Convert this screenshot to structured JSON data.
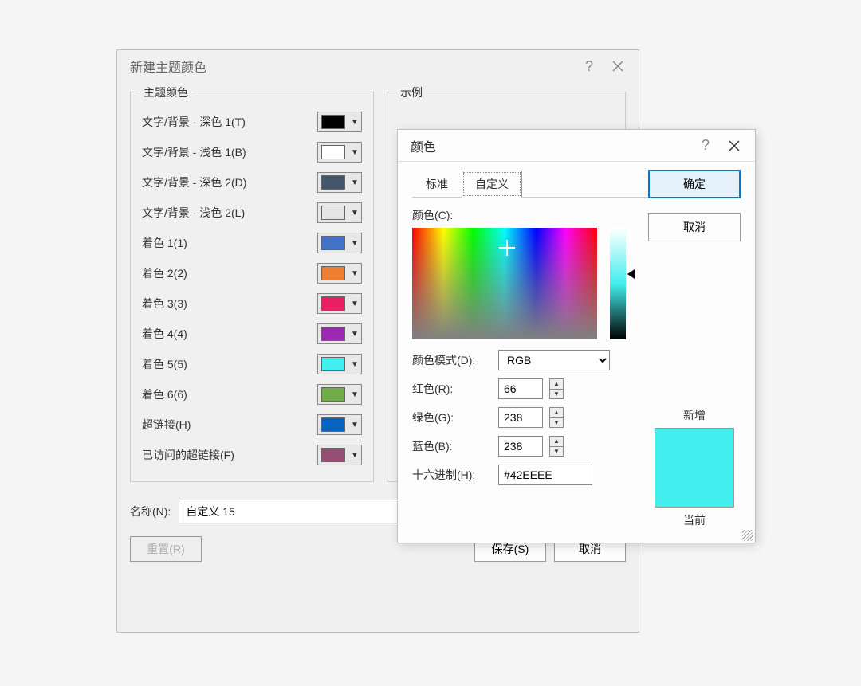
{
  "themeDialog": {
    "title": "新建主题颜色",
    "groupThemeColors": "主题颜色",
    "groupSample": "示例",
    "rows": [
      {
        "label": "文字/背景 - 深色 1(T)",
        "color": "#000000"
      },
      {
        "label": "文字/背景 - 浅色 1(B)",
        "color": "#ffffff"
      },
      {
        "label": "文字/背景 - 深色 2(D)",
        "color": "#44546a"
      },
      {
        "label": "文字/背景 - 浅色 2(L)",
        "color": "#e7e6e6"
      },
      {
        "label": "着色 1(1)",
        "color": "#4472c4"
      },
      {
        "label": "着色 2(2)",
        "color": "#ed7d31"
      },
      {
        "label": "着色 3(3)",
        "color": "#e91e63"
      },
      {
        "label": "着色 4(4)",
        "color": "#9c27b0"
      },
      {
        "label": "着色 5(5)",
        "color": "#42eeee"
      },
      {
        "label": "着色 6(6)",
        "color": "#70ad47"
      },
      {
        "label": "超链接(H)",
        "color": "#0563c1"
      },
      {
        "label": "已访问的超链接(F)",
        "color": "#954f72"
      }
    ],
    "nameLabel": "名称(N):",
    "nameValue": "自定义 15",
    "reset": "重置(R)",
    "save": "保存(S)",
    "cancel": "取消"
  },
  "colorDialog": {
    "title": "颜色",
    "tabStandard": "标准",
    "tabCustom": "自定义",
    "colorsLabel": "颜色(C):",
    "modeLabel": "颜色模式(D):",
    "modeValue": "RGB",
    "redLabel": "红色(R):",
    "redValue": "66",
    "greenLabel": "绿色(G):",
    "greenValue": "238",
    "blueLabel": "蓝色(B):",
    "blueValue": "238",
    "hexLabel": "十六进制(H):",
    "hexValue": "#42EEEE",
    "ok": "确定",
    "cancel": "取消",
    "newLabel": "新增",
    "currentLabel": "当前",
    "previewColor": "#42eeee"
  }
}
